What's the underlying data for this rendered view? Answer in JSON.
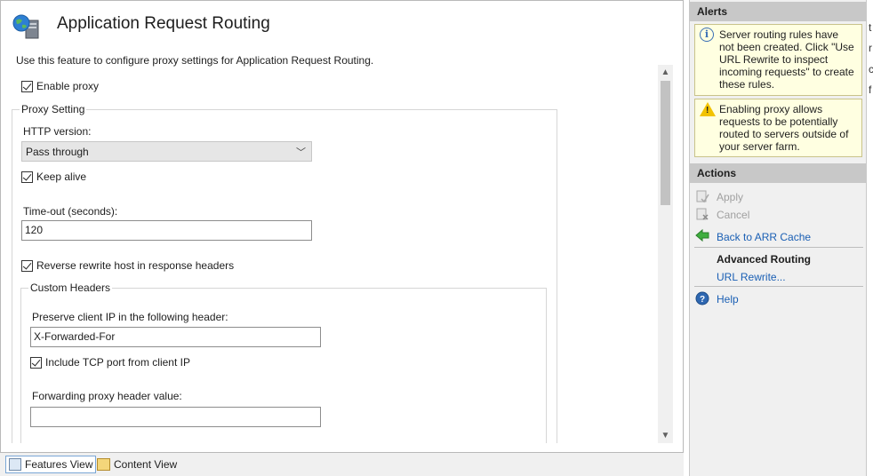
{
  "header": {
    "title": "Application Request Routing",
    "description": "Use this feature to configure proxy settings for Application Request Routing."
  },
  "form": {
    "enable_proxy_label": "Enable proxy",
    "proxy_setting_legend": "Proxy Setting",
    "http_version_label": "HTTP version:",
    "http_version_value": "Pass through",
    "keep_alive_label": "Keep alive",
    "timeout_label": "Time-out (seconds):",
    "timeout_value": "120",
    "reverse_rewrite_label": "Reverse rewrite host in response headers",
    "custom_headers_legend": "Custom Headers",
    "preserve_ip_label": "Preserve client IP in the following header:",
    "preserve_ip_value": "X-Forwarded-For",
    "include_tcp_port_label": "Include TCP port from client IP",
    "forwarding_proxy_label": "Forwarding proxy header value:",
    "forwarding_proxy_value": ""
  },
  "bottom_tabs": [
    {
      "label": "Features View",
      "active": true
    },
    {
      "label": "Content View",
      "active": false
    }
  ],
  "alerts_panel": {
    "title": "Alerts",
    "items": [
      {
        "type": "info",
        "text": "Server routing rules have not been created. Click \"Use URL Rewrite to inspect incoming requests\" to create these rules."
      },
      {
        "type": "warning",
        "text": "Enabling proxy allows requests to be potentially routed to servers outside of your server farm."
      }
    ]
  },
  "actions_panel": {
    "title": "Actions",
    "apply": "Apply",
    "cancel": "Cancel",
    "back": "Back to ARR Cache",
    "advanced_routing": "Advanced Routing",
    "url_rewrite": "URL Rewrite...",
    "help": "Help"
  },
  "edge_fragments": [
    "t",
    "r",
    "c",
    "f"
  ]
}
